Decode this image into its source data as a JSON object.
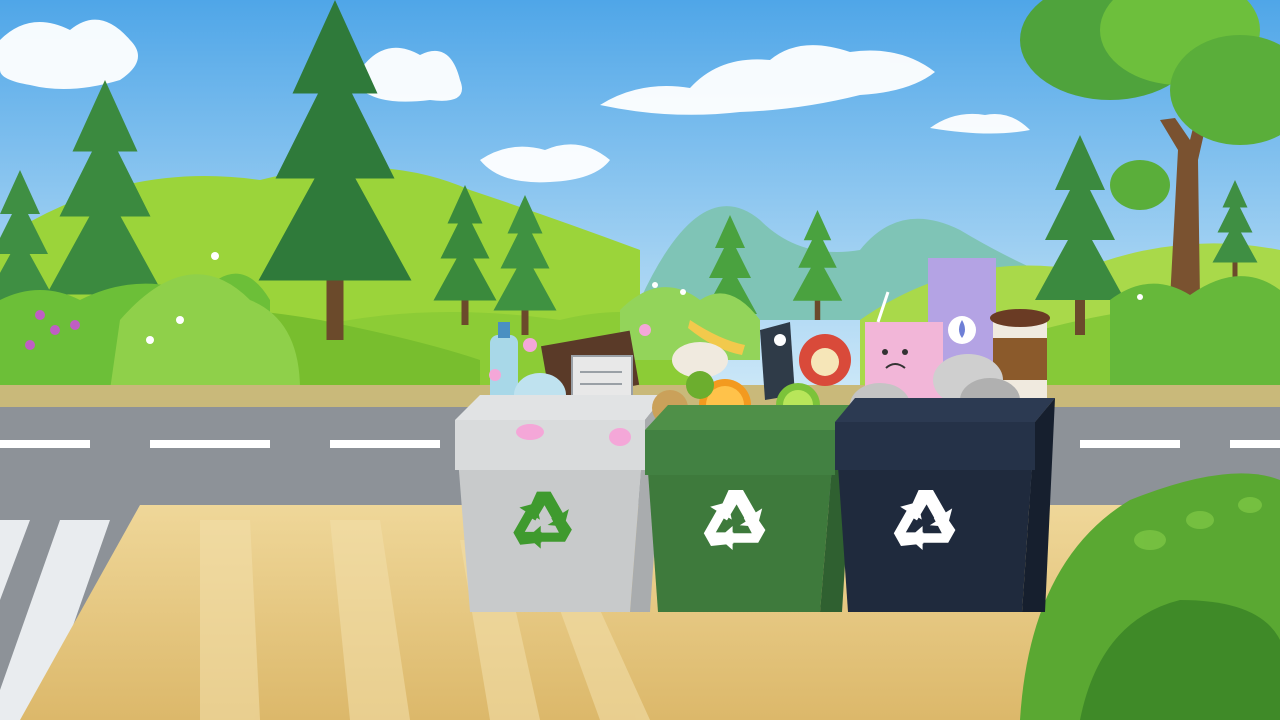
{
  "scene": {
    "sky_colors": [
      "#4fa6e8",
      "#bfe3f7"
    ],
    "hill_color": "#8fcf3a",
    "road_color": "#8d9298",
    "sidewalk_color": "#e6c97f"
  },
  "bins": [
    {
      "color": "#c8cacb",
      "symbol": "recycle-icon",
      "symbol_color": "#3f9a2e"
    },
    {
      "color": "#3e7a3c",
      "symbol": "recycle-icon",
      "symbol_color": "#ffffff"
    },
    {
      "color": "#1f2a3d",
      "symbol": "recycle-icon",
      "symbol_color": "#ffffff"
    }
  ]
}
